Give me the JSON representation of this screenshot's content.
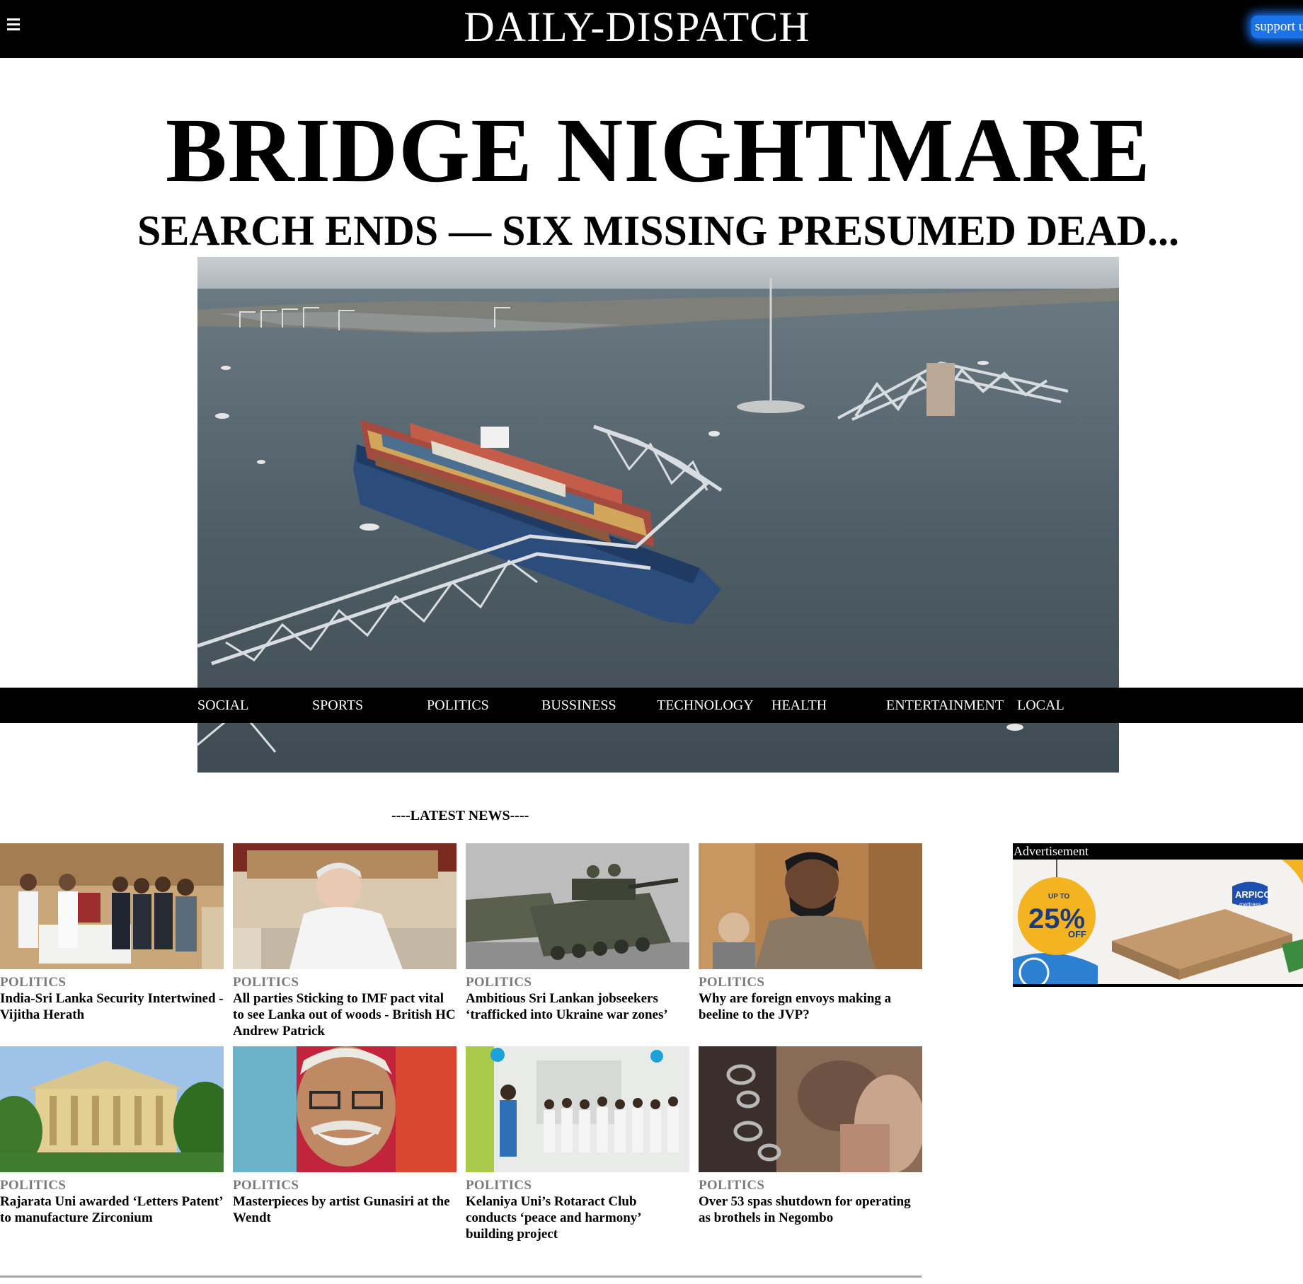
{
  "header": {
    "site_title": "DAILY-DISPATCH",
    "support_label": "support u",
    "menu_icon": "hamburger-menu-icon"
  },
  "lead": {
    "headline": "BRIDGE NIGHTMARE",
    "subheadline": "SEARCH ENDS — SIX MISSING PRESUMED DEAD..."
  },
  "nav": {
    "items": [
      "SOCIAL",
      "SPORTS",
      "POLITICS",
      "BUSSINESS",
      "TECHNOLOGY",
      "HEALTH",
      "ENTERTAINMENT",
      "LOCAL"
    ]
  },
  "latest": {
    "heading": "----LATEST NEWS----",
    "articles": [
      {
        "category": "POLITICS",
        "title": "India-Sri Lanka Security Intertwined - Vijitha Herath"
      },
      {
        "category": "POLITICS",
        "title": "All parties Sticking to IMF pact vital to see Lanka out of woods - British HC Andrew Patrick"
      },
      {
        "category": "POLITICS",
        "title": "Ambitious Sri Lankan jobseekers ‘trafficked into Ukraine war zones’"
      },
      {
        "category": "POLITICS",
        "title": "Why are foreign envoys making a beeline to the JVP?"
      },
      {
        "category": "POLITICS",
        "title": "Rajarata Uni awarded ‘Letters Patent’ to manufacture Zirconium"
      },
      {
        "category": "POLITICS",
        "title": "Masterpieces by artist Gunasiri at the Wendt"
      },
      {
        "category": "POLITICS",
        "title": "Kelaniya Uni’s Rotaract Club conducts ‘peace and harmony’ building project"
      },
      {
        "category": "POLITICS",
        "title": "Over 53 spas shutdown for operating as brothels in Negombo"
      }
    ]
  },
  "ad": {
    "label": "Advertisement",
    "badge_top": "UP TO",
    "badge_value": "25%",
    "badge_off": "OFF",
    "brand": "ARPICO",
    "brand_sub": "mattress"
  },
  "colors": {
    "topbar": "#000000",
    "support_button": "#1a73e8",
    "category_gray": "#7a7a7a",
    "ad_badge": "#f4b321"
  }
}
